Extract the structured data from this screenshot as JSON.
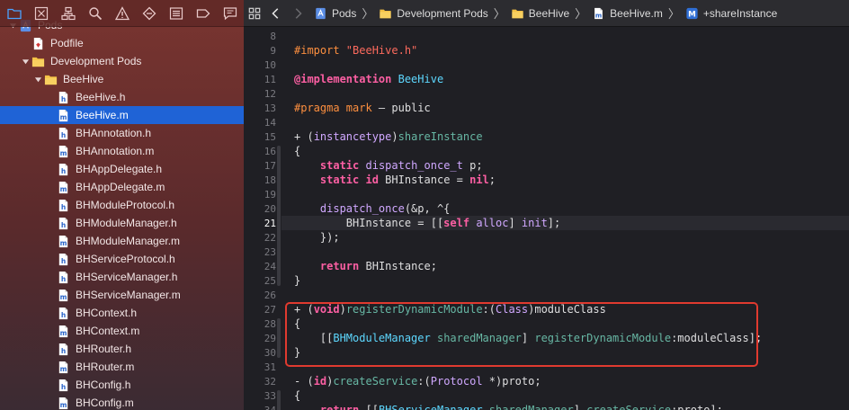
{
  "sidebar": {
    "toolbar_icons": [
      "folder-icon",
      "x-square-icon",
      "hierarchy-icon",
      "search-icon",
      "warning-icon",
      "diamond-icon",
      "list-icon",
      "tag-icon",
      "chat-icon"
    ],
    "items": [
      {
        "label": "Pods",
        "kind": "project",
        "depth": 0,
        "expanded": true
      },
      {
        "label": "Podfile",
        "kind": "file-rb",
        "depth": 1
      },
      {
        "label": "Development Pods",
        "kind": "folder",
        "depth": 1,
        "expanded": true
      },
      {
        "label": "BeeHive",
        "kind": "folder",
        "depth": 2,
        "expanded": true
      },
      {
        "label": "BeeHive.h",
        "kind": "file-h",
        "depth": 3
      },
      {
        "label": "BeeHive.m",
        "kind": "file-m",
        "depth": 3,
        "selected": true
      },
      {
        "label": "BHAnnotation.h",
        "kind": "file-h",
        "depth": 3
      },
      {
        "label": "BHAnnotation.m",
        "kind": "file-m",
        "depth": 3
      },
      {
        "label": "BHAppDelegate.h",
        "kind": "file-h",
        "depth": 3
      },
      {
        "label": "BHAppDelegate.m",
        "kind": "file-m",
        "depth": 3
      },
      {
        "label": "BHModuleProtocol.h",
        "kind": "file-h",
        "depth": 3
      },
      {
        "label": "BHModuleManager.h",
        "kind": "file-h",
        "depth": 3
      },
      {
        "label": "BHModuleManager.m",
        "kind": "file-m",
        "depth": 3
      },
      {
        "label": "BHServiceProtocol.h",
        "kind": "file-h",
        "depth": 3
      },
      {
        "label": "BHServiceManager.h",
        "kind": "file-h",
        "depth": 3
      },
      {
        "label": "BHServiceManager.m",
        "kind": "file-m",
        "depth": 3
      },
      {
        "label": "BHContext.h",
        "kind": "file-h",
        "depth": 3
      },
      {
        "label": "BHContext.m",
        "kind": "file-m",
        "depth": 3
      },
      {
        "label": "BHRouter.h",
        "kind": "file-h",
        "depth": 3
      },
      {
        "label": "BHRouter.m",
        "kind": "file-m",
        "depth": 3
      },
      {
        "label": "BHConfig.h",
        "kind": "file-h",
        "depth": 3
      },
      {
        "label": "BHConfig.m",
        "kind": "file-m",
        "depth": 3
      }
    ]
  },
  "jumpbar": {
    "crumbs": [
      {
        "label": "Pods",
        "icon": "project-icon"
      },
      {
        "label": "Development Pods",
        "icon": "folder-icon"
      },
      {
        "label": "BeeHive",
        "icon": "folder-icon"
      },
      {
        "label": "BeeHive.m",
        "icon": "file-m-icon"
      },
      {
        "label": "+shareInstance",
        "icon": "method-icon"
      }
    ]
  },
  "editor": {
    "current_line": 21,
    "lines": [
      {
        "n": 8,
        "tokens": []
      },
      {
        "n": 9,
        "tokens": [
          [
            "pp",
            "#import "
          ],
          [
            "str",
            "\"BeeHive.h\""
          ]
        ]
      },
      {
        "n": 10,
        "tokens": []
      },
      {
        "n": 11,
        "tokens": [
          [
            "kw",
            "@implementation"
          ],
          [
            "pl",
            " "
          ],
          [
            "cls",
            "BeeHive"
          ]
        ]
      },
      {
        "n": 12,
        "tokens": []
      },
      {
        "n": 13,
        "tokens": [
          [
            "pp",
            "#pragma mark"
          ],
          [
            "pl",
            " – public"
          ]
        ]
      },
      {
        "n": 14,
        "tokens": []
      },
      {
        "n": 15,
        "tokens": [
          [
            "pl",
            "+ ("
          ],
          [
            "ty",
            "instancetype"
          ],
          [
            "pl",
            ")"
          ],
          [
            "fn",
            "shareInstance"
          ]
        ]
      },
      {
        "n": 16,
        "tokens": [
          [
            "pl",
            "{"
          ]
        ]
      },
      {
        "n": 17,
        "tokens": [
          [
            "pl",
            "    "
          ],
          [
            "kw",
            "static"
          ],
          [
            "pl",
            " "
          ],
          [
            "ty",
            "dispatch_once_t"
          ],
          [
            "pl",
            " p;"
          ]
        ]
      },
      {
        "n": 18,
        "tokens": [
          [
            "pl",
            "    "
          ],
          [
            "kw",
            "static"
          ],
          [
            "pl",
            " "
          ],
          [
            "kw",
            "id"
          ],
          [
            "pl",
            " BHInstance = "
          ],
          [
            "kw",
            "nil"
          ],
          [
            "pl",
            ";"
          ]
        ]
      },
      {
        "n": 19,
        "tokens": []
      },
      {
        "n": 20,
        "tokens": [
          [
            "pl",
            "    "
          ],
          [
            "ty",
            "dispatch_once"
          ],
          [
            "pl",
            "(&p, ^{"
          ]
        ]
      },
      {
        "n": 21,
        "tokens": [
          [
            "pl",
            "        BHInstance = [["
          ],
          [
            "kw",
            "self"
          ],
          [
            "pl",
            " "
          ],
          [
            "ty",
            "alloc"
          ],
          [
            "pl",
            "] "
          ],
          [
            "ty",
            "init"
          ],
          [
            "pl",
            "];"
          ]
        ]
      },
      {
        "n": 22,
        "tokens": [
          [
            "pl",
            "    });"
          ]
        ]
      },
      {
        "n": 23,
        "tokens": []
      },
      {
        "n": 24,
        "tokens": [
          [
            "pl",
            "    "
          ],
          [
            "kw",
            "return"
          ],
          [
            "pl",
            " BHInstance;"
          ]
        ]
      },
      {
        "n": 25,
        "tokens": [
          [
            "pl",
            "}"
          ]
        ]
      },
      {
        "n": 26,
        "tokens": []
      },
      {
        "n": 27,
        "tokens": [
          [
            "pl",
            "+ ("
          ],
          [
            "kw",
            "void"
          ],
          [
            "pl",
            ")"
          ],
          [
            "fn",
            "registerDynamicModule"
          ],
          [
            "pl",
            ":("
          ],
          [
            "ty",
            "Class"
          ],
          [
            "pl",
            ")moduleClass"
          ]
        ]
      },
      {
        "n": 28,
        "tokens": [
          [
            "pl",
            "{"
          ]
        ]
      },
      {
        "n": 29,
        "tokens": [
          [
            "pl",
            "    [["
          ],
          [
            "cls",
            "BHModuleManager"
          ],
          [
            "pl",
            " "
          ],
          [
            "fn",
            "sharedManager"
          ],
          [
            "pl",
            "] "
          ],
          [
            "fn",
            "registerDynamicModule"
          ],
          [
            "pl",
            ":moduleClass];"
          ]
        ]
      },
      {
        "n": 30,
        "tokens": [
          [
            "pl",
            "}"
          ]
        ]
      },
      {
        "n": 31,
        "tokens": []
      },
      {
        "n": 32,
        "tokens": [
          [
            "pl",
            "- ("
          ],
          [
            "kw",
            "id"
          ],
          [
            "pl",
            ")"
          ],
          [
            "fn",
            "createService"
          ],
          [
            "pl",
            ":("
          ],
          [
            "ty",
            "Protocol"
          ],
          [
            "pl",
            " *)proto;"
          ]
        ]
      },
      {
        "n": 33,
        "tokens": [
          [
            "pl",
            "{"
          ]
        ]
      },
      {
        "n": 34,
        "tokens": [
          [
            "pl",
            "    "
          ],
          [
            "kw",
            "return"
          ],
          [
            "pl",
            " [["
          ],
          [
            "cls",
            "BHServiceManager"
          ],
          [
            "pl",
            " "
          ],
          [
            "fn",
            "sharedManager"
          ],
          [
            "pl",
            "] "
          ],
          [
            "fn",
            "createService"
          ],
          [
            "pl",
            ":proto];"
          ]
        ]
      }
    ]
  },
  "colors": {
    "selection": "#1f63d6",
    "highlight_border": "#e03a2f",
    "editor_bg": "#1f1f24"
  }
}
